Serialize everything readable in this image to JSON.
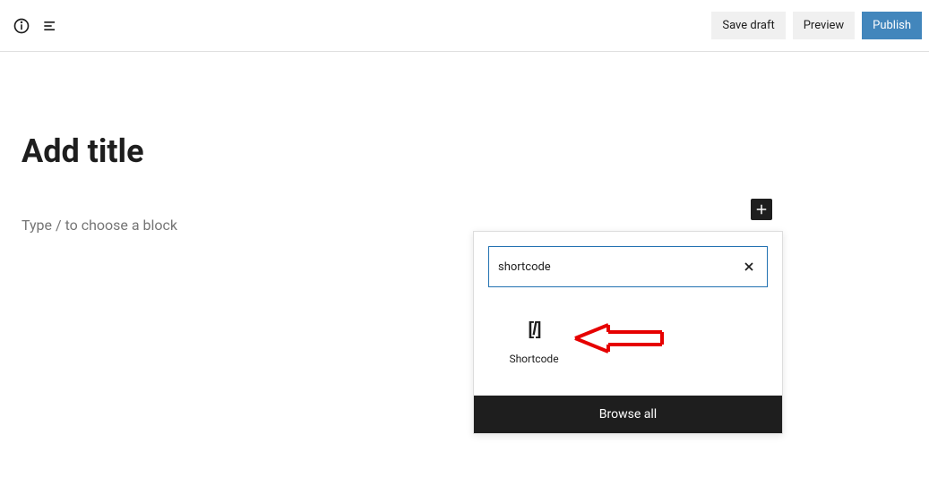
{
  "toolbar": {
    "save_draft_label": "Save draft",
    "preview_label": "Preview",
    "publish_label": "Publish"
  },
  "editor": {
    "title_placeholder": "Add title",
    "block_placeholder": "Type / to choose a block"
  },
  "inserter": {
    "search_value": "shortcode",
    "block_icon": "[/]",
    "block_label": "Shortcode",
    "browse_all_label": "Browse all"
  }
}
